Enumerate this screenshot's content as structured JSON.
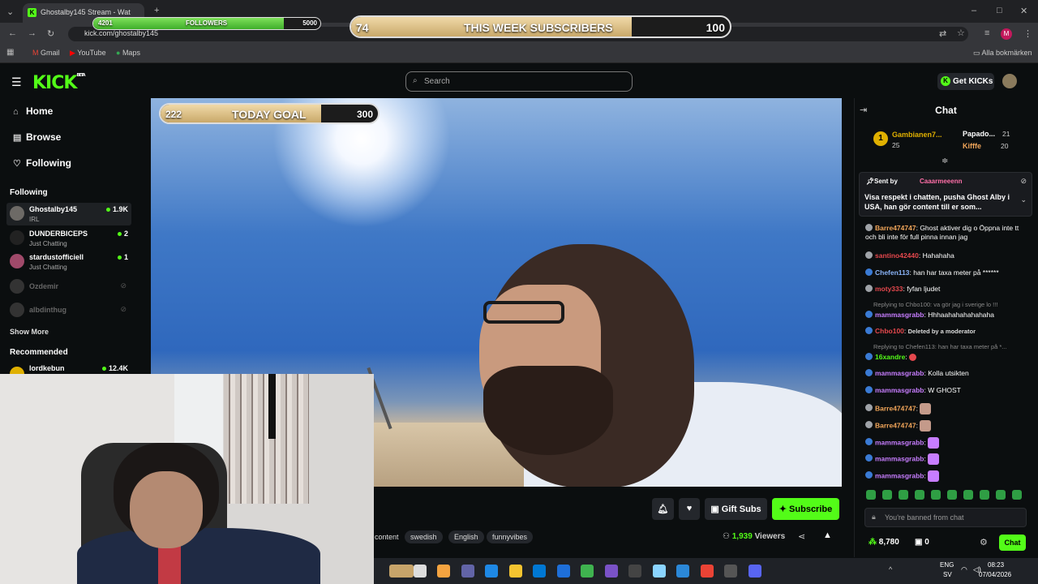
{
  "browser": {
    "tab_title": "Ghostalby145 Stream - Wat",
    "url": "kick.com/ghostalby145",
    "bookmarks": [
      "Gmail",
      "YouTube",
      "Maps"
    ],
    "all_bookmarks": "Alla bokmärken",
    "profile_initial": "M"
  },
  "overlays": {
    "followers": {
      "label": "FOLLOWERS",
      "current": "4201",
      "goal": "5000",
      "fraction": 0.84
    },
    "subs": {
      "label": "THIS WEEK SUBSCRIBERS",
      "current": "74",
      "goal": "100",
      "fraction": 0.74
    },
    "today": {
      "label": "TODAY GOAL",
      "current": "222",
      "goal": "300",
      "fraction": 0.74
    }
  },
  "header": {
    "logo": "KICK",
    "logo_beta": "BETA",
    "search_placeholder": "Search",
    "get_kicks": "Get KICKs"
  },
  "sidebar": {
    "nav": [
      {
        "label": "Home",
        "icon": "home-icon"
      },
      {
        "label": "Browse",
        "icon": "browse-icon"
      },
      {
        "label": "Following",
        "icon": "heart-icon"
      }
    ],
    "following_title": "Following",
    "following": [
      {
        "name": "Ghostalby145",
        "sub": "IRL",
        "count": "1.9K"
      },
      {
        "name": "DUNDERBICEPS",
        "sub": "Just Chatting",
        "count": "2"
      },
      {
        "name": "stardustofficiell",
        "sub": "Just Chatting",
        "count": "1"
      },
      {
        "name": "Ozdemir",
        "sub": "",
        "count": ""
      },
      {
        "name": "albdinthug",
        "sub": "",
        "count": ""
      }
    ],
    "show_more": "Show More",
    "recommended_title": "Recommended",
    "recommended": [
      {
        "name": "lordkebun",
        "count": "12.4K"
      }
    ]
  },
  "stream": {
    "gift_subs": "Gift Subs",
    "subscribe": "Subscribe",
    "tags": [
      "content",
      "swedish",
      "English",
      "funnyvibes"
    ],
    "viewers": "1,939",
    "viewers_label": "Viewers"
  },
  "chat": {
    "title": "Chat",
    "leaderboard": [
      {
        "rank": "1",
        "name": "Gambianen7...",
        "count": "25"
      },
      {
        "name": "Papado...",
        "count": "21"
      },
      {
        "name": "Kifffe",
        "count": "20"
      }
    ],
    "pinned": {
      "sent_by": "Sent by",
      "user": "Caaarmeeenn",
      "text": "Visa respekt i chatten, pusha Ghost Alby i USA, han gör content till er som..."
    },
    "messages": [
      {
        "user": "Barre474747",
        "text": "Ghost aktiver dig o Öppna inte tt och bli inte för full pinna innan jag",
        "color": "#f2a65a"
      },
      {
        "user": "santino42440",
        "text": "Hahahaha",
        "color": "#e5484d"
      },
      {
        "user": "Chefen113",
        "text": "han har taxa meter på ******",
        "color": "#8ab4f8"
      },
      {
        "user": "moty333",
        "text": "fyfan ljudet",
        "color": "#e5484d"
      },
      {
        "reply": "Replying to Chbo100: va gör jag i sverige lo !!!",
        "user": "mammasgrabb",
        "text": "Hhhaahahahahahaha",
        "color": "#c77dff"
      },
      {
        "user": "Chbo100",
        "text": "Deleted by a moderator",
        "color": "#e5484d",
        "deleted": true
      },
      {
        "reply": "Replying to Chefen113: han har taxa meter på *...",
        "user": "16xandre",
        "text": "",
        "color": "#53fc18"
      },
      {
        "user": "mammasgrabb",
        "text": "Kolla utsikten",
        "color": "#c77dff"
      },
      {
        "user": "mammasgrabb",
        "text": "W GHOST",
        "color": "#c77dff"
      },
      {
        "user": "Barre474747",
        "text": "",
        "color": "#f2a65a"
      },
      {
        "user": "Barre474747",
        "text": "",
        "color": "#f2a65a"
      },
      {
        "user": "mammasgrabb",
        "text": "",
        "color": "#c77dff"
      },
      {
        "user": "mammasgrabb",
        "text": "",
        "color": "#c77dff"
      },
      {
        "user": "mammasgrabb",
        "text": "",
        "color": "#c77dff"
      }
    ],
    "banned_placeholder": "You're banned from chat",
    "points": "8,780",
    "gifts": "0",
    "send_label": "Chat"
  },
  "taskbar": {
    "lang": "ENG",
    "lang_sub": "SV",
    "time": "08:23",
    "date": "07/04/2026"
  },
  "colors": {
    "accent": "#53fc18",
    "bg": "#0b0e0f"
  }
}
